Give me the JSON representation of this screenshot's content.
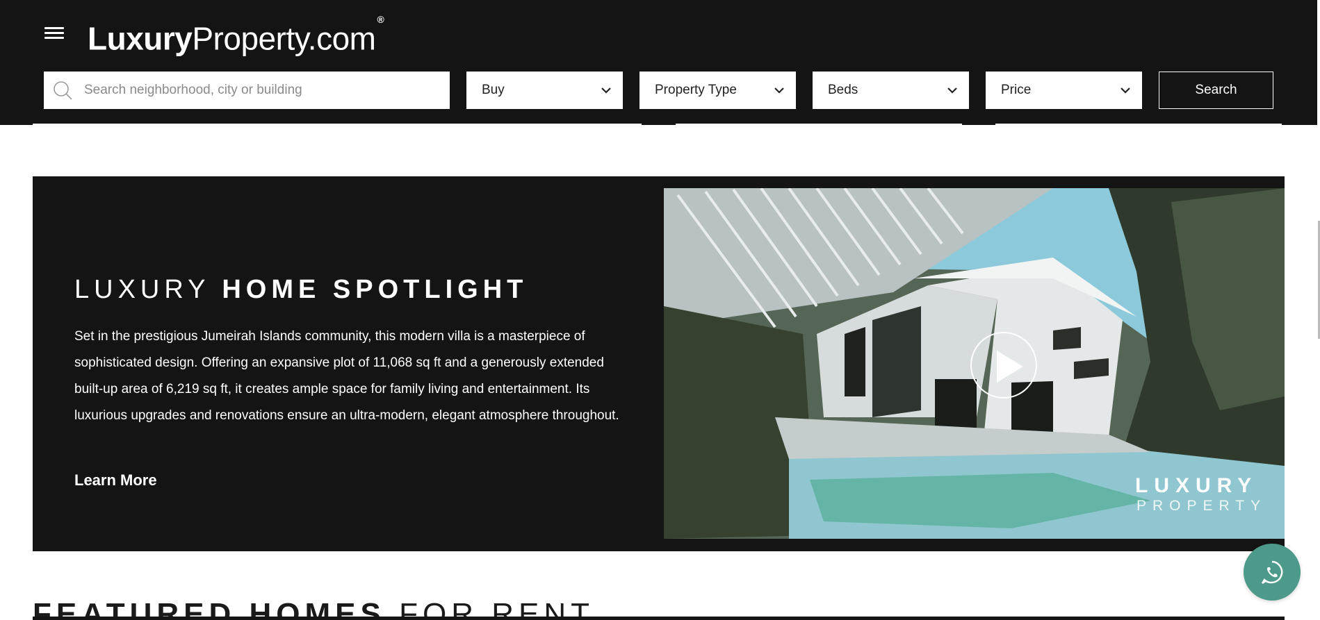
{
  "header": {
    "logo": {
      "bold": "Luxury",
      "light": "Property.com",
      "mark": "®"
    },
    "search_placeholder": "Search neighborhood, city or building",
    "filters": {
      "buy": "Buy",
      "property_type": "Property Type",
      "beds": "Beds",
      "price": "Price"
    },
    "search_button": "Search"
  },
  "spotlight": {
    "title_light": "LUXURY ",
    "title_bold": "HOME SPOTLIGHT",
    "description": "Set in the prestigious Jumeirah Islands community, this modern villa is a masterpiece of sophisticated design. Offering an expansive plot of 11,068 sq ft and a generously extended built-up area of 6,219 sq ft, it creates ample space for family living and entertainment. Its luxurious upgrades and renovations ensure an ultra-modern, elegant atmosphere throughout.",
    "learn_more": "Learn More",
    "video_watermark": {
      "line1": "LUXURY",
      "line2": "PROPERTY"
    }
  },
  "featured": {
    "title_bold": "FEATURED HOMES ",
    "title_light": "FOR RENT"
  },
  "colors": {
    "header_bg": "#141414",
    "spotlight_bg": "#141414",
    "whatsapp": "#4d9a8a"
  },
  "icons": [
    "menu-icon",
    "search-icon",
    "chevron-down-icon",
    "play-icon",
    "whatsapp-icon"
  ]
}
